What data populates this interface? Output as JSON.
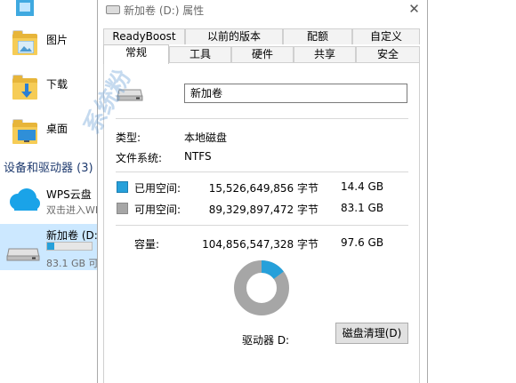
{
  "explorer": {
    "items": [
      {
        "label": "图片"
      },
      {
        "label": "下载"
      },
      {
        "label": "桌面"
      }
    ],
    "section": "设备和驱动器 (3)",
    "wps": {
      "label": "WPS云盘",
      "sub": "双击进入WP"
    },
    "drive": {
      "label": "新加卷 (D:)",
      "sub": "83.1 GB 可",
      "used_fraction": 0.15
    }
  },
  "dialog": {
    "title": "新加卷 (D:) 属性",
    "close_glyph": "✕",
    "tabs_top": [
      "ReadyBoost",
      "以前的版本",
      "配额",
      "自定义"
    ],
    "tabs_bottom": [
      "常规",
      "工具",
      "硬件",
      "共享",
      "安全"
    ],
    "active_tab": "常规",
    "volume_name": "新加卷",
    "type_label": "类型:",
    "type_value": "本地磁盘",
    "fs_label": "文件系统:",
    "fs_value": "NTFS",
    "used": {
      "label": "已用空间:",
      "bytes": "15,526,649,856 字节",
      "size": "14.4 GB",
      "color": "#26a0da"
    },
    "free": {
      "label": "可用空间:",
      "bytes": "89,329,897,472 字节",
      "size": "83.1 GB",
      "color": "#a6a6a6"
    },
    "capacity": {
      "label": "容量:",
      "bytes": "104,856,547,328 字节",
      "size": "97.6 GB"
    },
    "drive_label": "驱动器 D:",
    "cleanup_button": "磁盘清理(D)",
    "used_fraction": 0.1481
  },
  "watermark": "系统粉"
}
